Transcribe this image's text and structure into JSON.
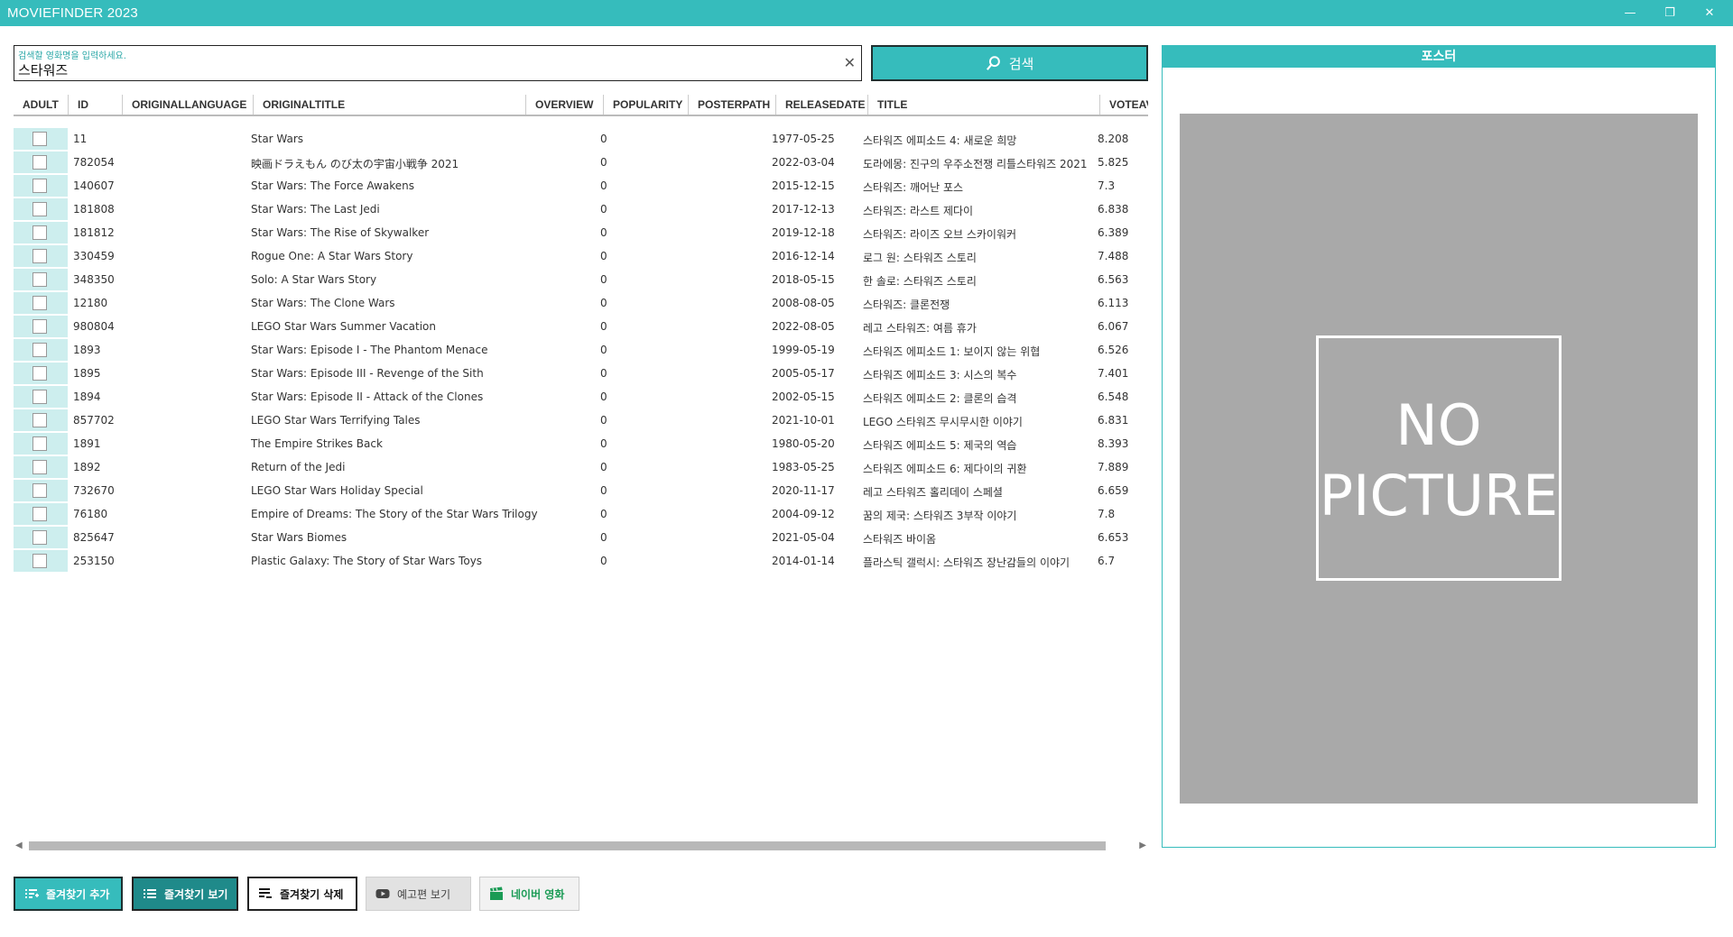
{
  "window": {
    "title": "MOVIEFINDER 2023",
    "minimize_glyph": "—",
    "maximize_glyph": "❐",
    "close_glyph": "✕"
  },
  "search": {
    "hint": "검색할 영화명을 입력하세요.",
    "value": "스타워즈",
    "clear_glyph": "✕",
    "button_label": "검색",
    "button_icon": "search-icon"
  },
  "columns": [
    "ADULT",
    "ID",
    "ORIGINALLANGUAGE",
    "ORIGINALTITLE",
    "OVERVIEW",
    "POPULARITY",
    "POSTERPATH",
    "RELEASEDATE",
    "TITLE",
    "VOTEAVE"
  ],
  "rows": [
    {
      "id": "11",
      "original_title": "Star Wars",
      "popularity": "0",
      "release_date": "1977-05-25",
      "title": "스타워즈 에피소드 4: 새로운 희망",
      "vote": "8.208"
    },
    {
      "id": "782054",
      "original_title": "映画ドラえもん のび太の宇宙小戦争 2021",
      "popularity": "0",
      "release_date": "2022-03-04",
      "title": "도라에몽: 진구의 우주소전쟁 리틀스타워즈 2021",
      "vote": "5.825"
    },
    {
      "id": "140607",
      "original_title": "Star Wars: The Force Awakens",
      "popularity": "0",
      "release_date": "2015-12-15",
      "title": "스타워즈: 깨어난 포스",
      "vote": "7.3"
    },
    {
      "id": "181808",
      "original_title": "Star Wars: The Last Jedi",
      "popularity": "0",
      "release_date": "2017-12-13",
      "title": "스타워즈: 라스트 제다이",
      "vote": "6.838"
    },
    {
      "id": "181812",
      "original_title": "Star Wars: The Rise of Skywalker",
      "popularity": "0",
      "release_date": "2019-12-18",
      "title": "스타워즈: 라이즈 오브 스카이워커",
      "vote": "6.389"
    },
    {
      "id": "330459",
      "original_title": "Rogue One: A Star Wars Story",
      "popularity": "0",
      "release_date": "2016-12-14",
      "title": "로그 원: 스타워즈 스토리",
      "vote": "7.488"
    },
    {
      "id": "348350",
      "original_title": "Solo: A Star Wars Story",
      "popularity": "0",
      "release_date": "2018-05-15",
      "title": "한 솔로: 스타워즈 스토리",
      "vote": "6.563"
    },
    {
      "id": "12180",
      "original_title": "Star Wars: The Clone Wars",
      "popularity": "0",
      "release_date": "2008-08-05",
      "title": "스타워즈: 클론전쟁",
      "vote": "6.113"
    },
    {
      "id": "980804",
      "original_title": "LEGO Star Wars Summer Vacation",
      "popularity": "0",
      "release_date": "2022-08-05",
      "title": "레고 스타워즈: 여름 휴가",
      "vote": "6.067"
    },
    {
      "id": "1893",
      "original_title": "Star Wars: Episode I - The Phantom Menace",
      "popularity": "0",
      "release_date": "1999-05-19",
      "title": "스타워즈 에피소드 1: 보이지 않는 위협",
      "vote": "6.526"
    },
    {
      "id": "1895",
      "original_title": "Star Wars: Episode III - Revenge of the Sith",
      "popularity": "0",
      "release_date": "2005-05-17",
      "title": "스타워즈 에피소드 3: 시스의 복수",
      "vote": "7.401"
    },
    {
      "id": "1894",
      "original_title": "Star Wars: Episode II - Attack of the Clones",
      "popularity": "0",
      "release_date": "2002-05-15",
      "title": "스타워즈 에피소드 2: 클론의 습격",
      "vote": "6.548"
    },
    {
      "id": "857702",
      "original_title": "LEGO Star Wars Terrifying Tales",
      "popularity": "0",
      "release_date": "2021-10-01",
      "title": "LEGO 스타워즈 무시무시한 이야기",
      "vote": "6.831"
    },
    {
      "id": "1891",
      "original_title": "The Empire Strikes Back",
      "popularity": "0",
      "release_date": "1980-05-20",
      "title": "스타워즈 에피소드 5: 제국의 역습",
      "vote": "8.393"
    },
    {
      "id": "1892",
      "original_title": "Return of the Jedi",
      "popularity": "0",
      "release_date": "1983-05-25",
      "title": "스타워즈 에피소드 6: 제다이의 귀환",
      "vote": "7.889"
    },
    {
      "id": "732670",
      "original_title": "LEGO Star Wars Holiday Special",
      "popularity": "0",
      "release_date": "2020-11-17",
      "title": "레고 스타워즈 홀리데이 스페셜",
      "vote": "6.659"
    },
    {
      "id": "76180",
      "original_title": "Empire of Dreams: The Story of the Star Wars Trilogy",
      "popularity": "0",
      "release_date": "2004-09-12",
      "title": "꿈의 제국: 스타워즈 3부작 이야기",
      "vote": "7.8"
    },
    {
      "id": "825647",
      "original_title": "Star Wars Biomes",
      "popularity": "0",
      "release_date": "2021-05-04",
      "title": "스타워즈 바이옴",
      "vote": "6.653"
    },
    {
      "id": "253150",
      "original_title": "Plastic Galaxy: The Story of Star Wars Toys",
      "popularity": "0",
      "release_date": "2014-01-14",
      "title": "플라스틱 갤럭시: 스타워즈 장난감들의 이야기",
      "vote": "6.7"
    }
  ],
  "scrollbar": {
    "left_glyph": "◀",
    "right_glyph": "▶"
  },
  "poster": {
    "header": "포스터",
    "placeholder_line1": "NO",
    "placeholder_line2": "PICTURE"
  },
  "buttons": {
    "add_favorite": "즐겨찾기 추가",
    "view_favorites": "즐겨찾기 보기",
    "delete_favorite": "즐겨찾기 삭제",
    "view_trailer": "예고편 보기",
    "naver_movie": "네이버 영화"
  },
  "colors": {
    "accent": "#36bcbc",
    "accent_dark": "#1f8a8a",
    "row_adult_bg": "#cdeeee",
    "naver_green": "#1a9b55",
    "poster_bg": "#a9a9a9"
  }
}
